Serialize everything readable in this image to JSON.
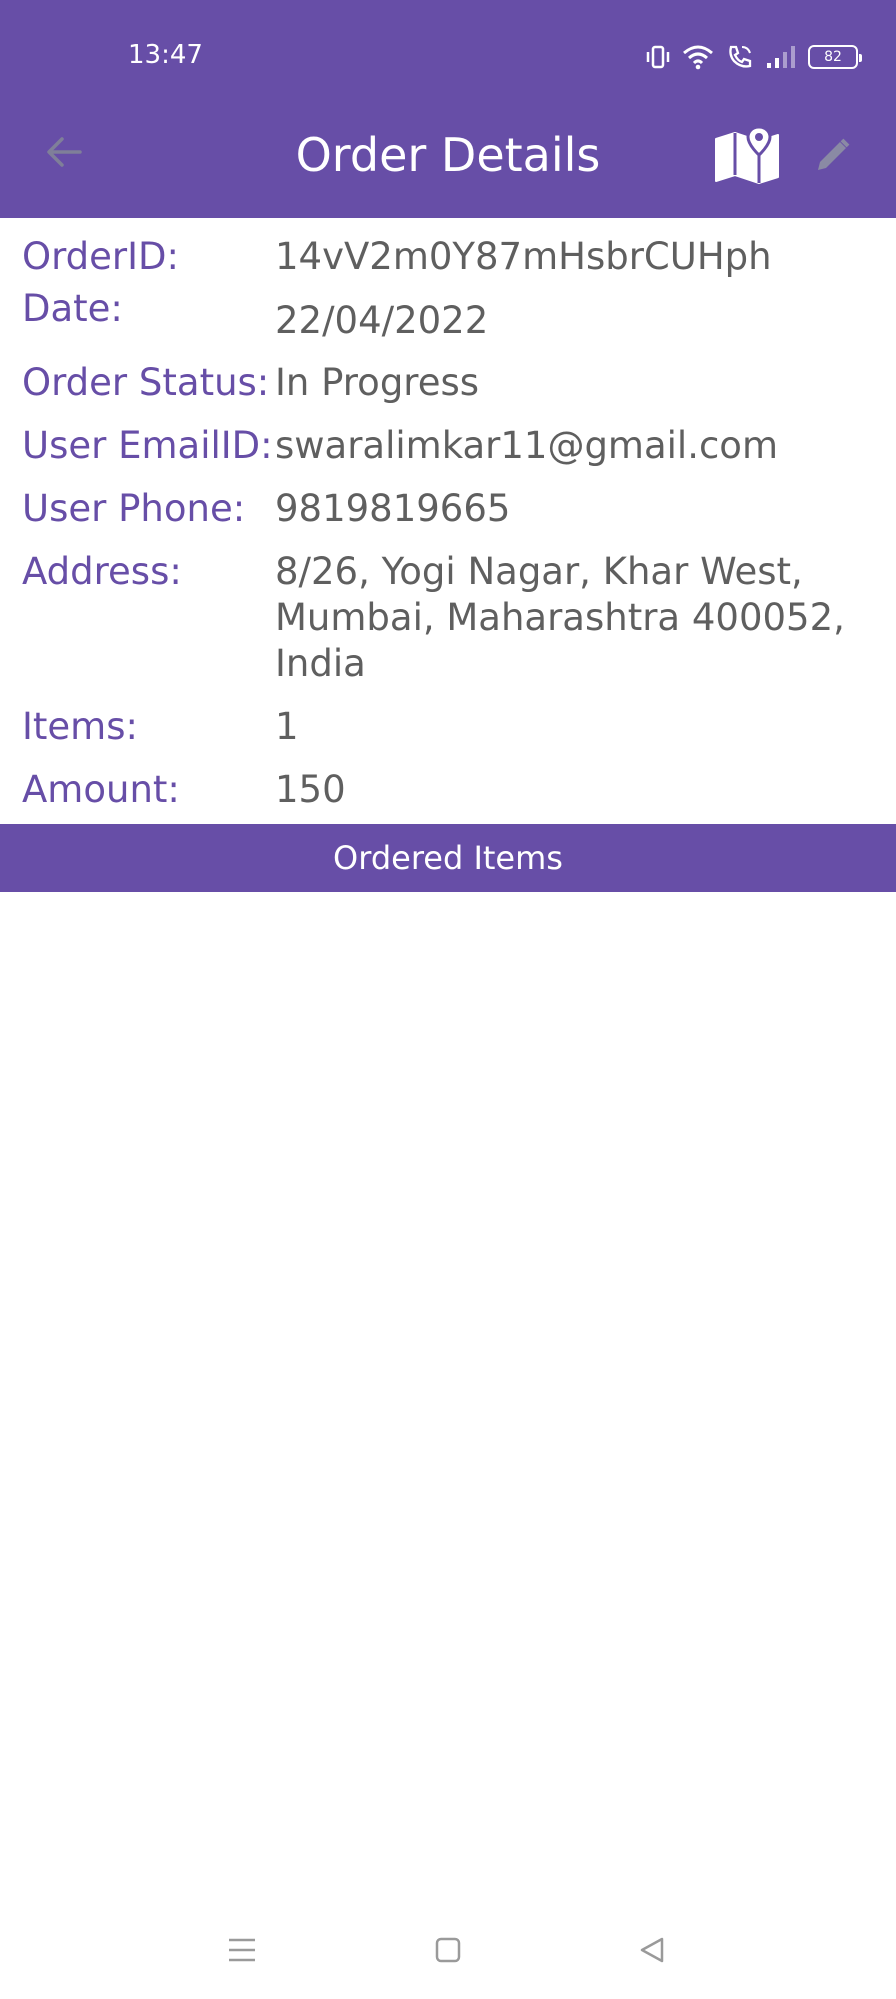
{
  "status_bar": {
    "time": "13:47",
    "battery_level": "82",
    "icons": [
      "vibrate-icon",
      "wifi-icon",
      "wifi-call-icon",
      "signal-icon",
      "battery-icon"
    ]
  },
  "toolbar": {
    "title": "Order Details",
    "back_icon": "arrow-left-icon",
    "map_icon": "map-icon",
    "edit_icon": "pencil-icon"
  },
  "order": {
    "order_id_label": "OrderID:",
    "order_id": "14vV2m0Y87mHsbrCUHph",
    "date_label": "Date:",
    "date": "22/04/2022",
    "status_label": "Order Status:",
    "status": "In Progress",
    "email_label": "User EmailID:",
    "email": "swaralimkar11@gmail.com",
    "phone_label": "User Phone:",
    "phone": "9819819665",
    "address_label": "Address:",
    "address": "8/26, Yogi Nagar, Khar West, Mumbai, Maharashtra 400052, India",
    "items_label": "Items:",
    "items": "1",
    "amount_label": "Amount:",
    "amount": "150"
  },
  "ordered_items": {
    "header": "Ordered Items"
  },
  "nav_bar": {
    "icons": [
      "menu-icon",
      "home-icon",
      "back-triangle-icon"
    ]
  },
  "colors": {
    "primary": "#674ea7",
    "value_text": "#5f5f5f",
    "background": "#ffffff"
  }
}
